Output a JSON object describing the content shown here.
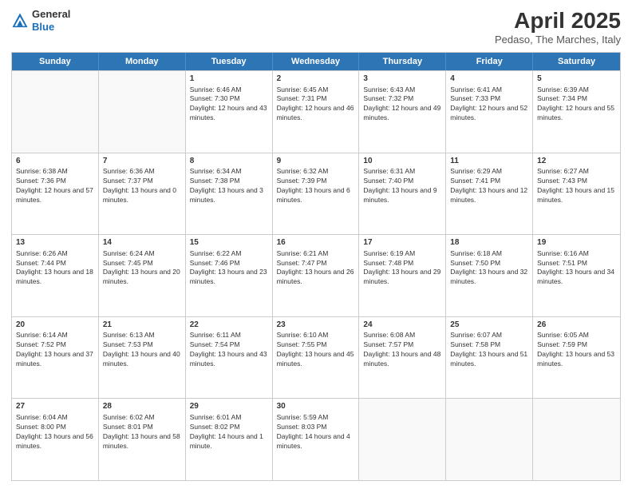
{
  "header": {
    "logo": {
      "general": "General",
      "blue": "Blue"
    },
    "title": "April 2025",
    "subtitle": "Pedaso, The Marches, Italy"
  },
  "days_of_week": [
    "Sunday",
    "Monday",
    "Tuesday",
    "Wednesday",
    "Thursday",
    "Friday",
    "Saturday"
  ],
  "weeks": [
    [
      {
        "day": "",
        "info": ""
      },
      {
        "day": "",
        "info": ""
      },
      {
        "day": "1",
        "info": "Sunrise: 6:46 AM\nSunset: 7:30 PM\nDaylight: 12 hours and 43 minutes."
      },
      {
        "day": "2",
        "info": "Sunrise: 6:45 AM\nSunset: 7:31 PM\nDaylight: 12 hours and 46 minutes."
      },
      {
        "day": "3",
        "info": "Sunrise: 6:43 AM\nSunset: 7:32 PM\nDaylight: 12 hours and 49 minutes."
      },
      {
        "day": "4",
        "info": "Sunrise: 6:41 AM\nSunset: 7:33 PM\nDaylight: 12 hours and 52 minutes."
      },
      {
        "day": "5",
        "info": "Sunrise: 6:39 AM\nSunset: 7:34 PM\nDaylight: 12 hours and 55 minutes."
      }
    ],
    [
      {
        "day": "6",
        "info": "Sunrise: 6:38 AM\nSunset: 7:36 PM\nDaylight: 12 hours and 57 minutes."
      },
      {
        "day": "7",
        "info": "Sunrise: 6:36 AM\nSunset: 7:37 PM\nDaylight: 13 hours and 0 minutes."
      },
      {
        "day": "8",
        "info": "Sunrise: 6:34 AM\nSunset: 7:38 PM\nDaylight: 13 hours and 3 minutes."
      },
      {
        "day": "9",
        "info": "Sunrise: 6:32 AM\nSunset: 7:39 PM\nDaylight: 13 hours and 6 minutes."
      },
      {
        "day": "10",
        "info": "Sunrise: 6:31 AM\nSunset: 7:40 PM\nDaylight: 13 hours and 9 minutes."
      },
      {
        "day": "11",
        "info": "Sunrise: 6:29 AM\nSunset: 7:41 PM\nDaylight: 13 hours and 12 minutes."
      },
      {
        "day": "12",
        "info": "Sunrise: 6:27 AM\nSunset: 7:43 PM\nDaylight: 13 hours and 15 minutes."
      }
    ],
    [
      {
        "day": "13",
        "info": "Sunrise: 6:26 AM\nSunset: 7:44 PM\nDaylight: 13 hours and 18 minutes."
      },
      {
        "day": "14",
        "info": "Sunrise: 6:24 AM\nSunset: 7:45 PM\nDaylight: 13 hours and 20 minutes."
      },
      {
        "day": "15",
        "info": "Sunrise: 6:22 AM\nSunset: 7:46 PM\nDaylight: 13 hours and 23 minutes."
      },
      {
        "day": "16",
        "info": "Sunrise: 6:21 AM\nSunset: 7:47 PM\nDaylight: 13 hours and 26 minutes."
      },
      {
        "day": "17",
        "info": "Sunrise: 6:19 AM\nSunset: 7:48 PM\nDaylight: 13 hours and 29 minutes."
      },
      {
        "day": "18",
        "info": "Sunrise: 6:18 AM\nSunset: 7:50 PM\nDaylight: 13 hours and 32 minutes."
      },
      {
        "day": "19",
        "info": "Sunrise: 6:16 AM\nSunset: 7:51 PM\nDaylight: 13 hours and 34 minutes."
      }
    ],
    [
      {
        "day": "20",
        "info": "Sunrise: 6:14 AM\nSunset: 7:52 PM\nDaylight: 13 hours and 37 minutes."
      },
      {
        "day": "21",
        "info": "Sunrise: 6:13 AM\nSunset: 7:53 PM\nDaylight: 13 hours and 40 minutes."
      },
      {
        "day": "22",
        "info": "Sunrise: 6:11 AM\nSunset: 7:54 PM\nDaylight: 13 hours and 43 minutes."
      },
      {
        "day": "23",
        "info": "Sunrise: 6:10 AM\nSunset: 7:55 PM\nDaylight: 13 hours and 45 minutes."
      },
      {
        "day": "24",
        "info": "Sunrise: 6:08 AM\nSunset: 7:57 PM\nDaylight: 13 hours and 48 minutes."
      },
      {
        "day": "25",
        "info": "Sunrise: 6:07 AM\nSunset: 7:58 PM\nDaylight: 13 hours and 51 minutes."
      },
      {
        "day": "26",
        "info": "Sunrise: 6:05 AM\nSunset: 7:59 PM\nDaylight: 13 hours and 53 minutes."
      }
    ],
    [
      {
        "day": "27",
        "info": "Sunrise: 6:04 AM\nSunset: 8:00 PM\nDaylight: 13 hours and 56 minutes."
      },
      {
        "day": "28",
        "info": "Sunrise: 6:02 AM\nSunset: 8:01 PM\nDaylight: 13 hours and 58 minutes."
      },
      {
        "day": "29",
        "info": "Sunrise: 6:01 AM\nSunset: 8:02 PM\nDaylight: 14 hours and 1 minute."
      },
      {
        "day": "30",
        "info": "Sunrise: 5:59 AM\nSunset: 8:03 PM\nDaylight: 14 hours and 4 minutes."
      },
      {
        "day": "",
        "info": ""
      },
      {
        "day": "",
        "info": ""
      },
      {
        "day": "",
        "info": ""
      }
    ]
  ]
}
